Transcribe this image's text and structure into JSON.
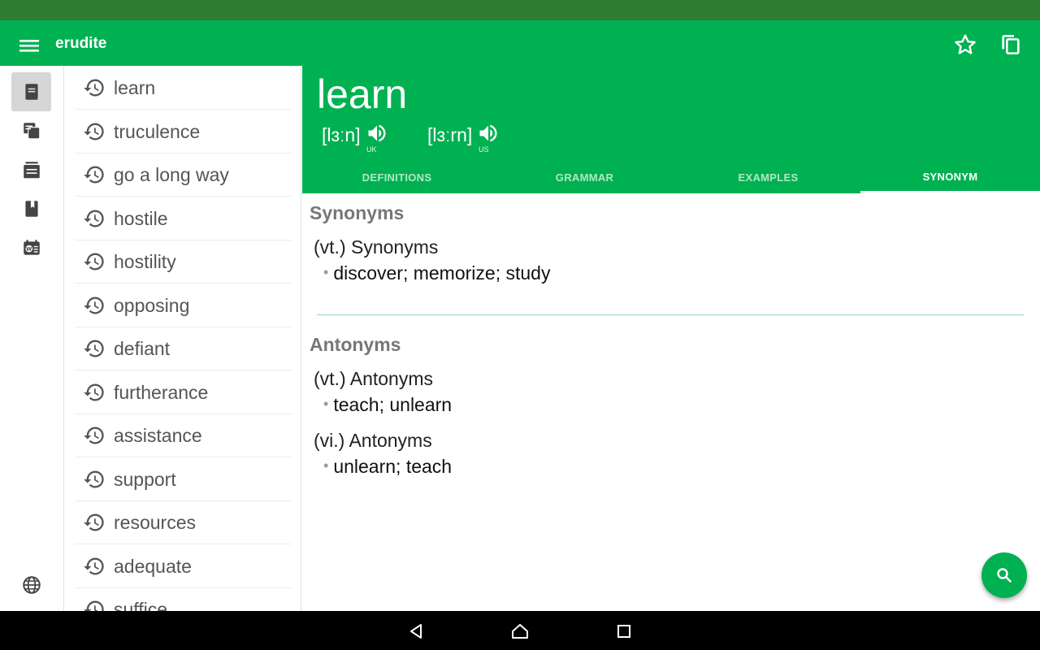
{
  "app": {
    "title": "erudite",
    "accent_color": "#00b152",
    "status_bar_color": "#2e7d32"
  },
  "appbar": {
    "icons": [
      "menu-icon",
      "star-icon",
      "copy-icon"
    ]
  },
  "rail": {
    "items": [
      {
        "name": "dictionary",
        "icon": "document-icon",
        "active": true
      },
      {
        "name": "cards",
        "icon": "cards-icon",
        "active": false
      },
      {
        "name": "list",
        "icon": "list-icon",
        "active": false
      },
      {
        "name": "book",
        "icon": "book-icon",
        "active": false
      },
      {
        "name": "word-of-day",
        "icon": "calendar-word-icon",
        "active": false
      },
      {
        "name": "language",
        "icon": "globe-icon",
        "active": false
      }
    ]
  },
  "history": {
    "items": [
      {
        "label": "learn"
      },
      {
        "label": "truculence"
      },
      {
        "label": "go a long way"
      },
      {
        "label": "hostile"
      },
      {
        "label": "hostility"
      },
      {
        "label": "opposing"
      },
      {
        "label": "defiant"
      },
      {
        "label": "furtherance"
      },
      {
        "label": "assistance"
      },
      {
        "label": "support"
      },
      {
        "label": "resources"
      },
      {
        "label": "adequate"
      },
      {
        "label": "suffice"
      }
    ]
  },
  "word": {
    "headword": "learn",
    "pron_uk": "[lɜːn]",
    "pron_us": "[lɜːrn]",
    "uk_label": "UK",
    "us_label": "US"
  },
  "tabs": [
    {
      "label": "DEFINITIONS",
      "active": false
    },
    {
      "label": "GRAMMAR",
      "active": false
    },
    {
      "label": "EXAMPLES",
      "active": false
    },
    {
      "label": "SYNONYM",
      "active": true
    }
  ],
  "synonyms": {
    "title": "Synonyms",
    "groups": [
      {
        "pos": "(vt.)",
        "label": "Synonyms",
        "words": "discover; memorize; study"
      }
    ]
  },
  "antonyms": {
    "title": "Antonyms",
    "groups": [
      {
        "pos": "(vt.)",
        "label": "Antonyms",
        "words": "teach; unlearn"
      },
      {
        "pos": "(vi.)",
        "label": "Antonyms",
        "words": "unlearn; teach"
      }
    ]
  },
  "fab": {
    "icon": "search-icon"
  },
  "navbar": {
    "icons": [
      "back-icon",
      "home-icon",
      "recents-icon"
    ]
  }
}
